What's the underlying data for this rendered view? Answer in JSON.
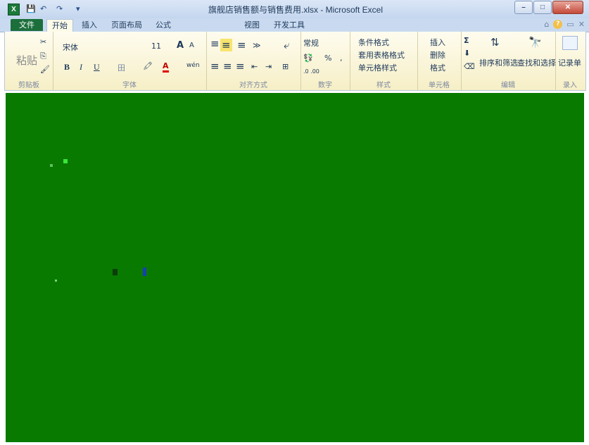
{
  "window": {
    "title": "旗舰店销售额与销售费用.xlsx - Microsoft Excel",
    "app_icon": "X",
    "min": "–",
    "max": "□",
    "close": "✕"
  },
  "qat": {
    "save": "💾",
    "undo": "↶",
    "redo": "↷",
    "more": "▾"
  },
  "tabs": [
    {
      "label": "文件"
    },
    {
      "label": "开始"
    },
    {
      "label": "插入"
    },
    {
      "label": "页面布局"
    },
    {
      "label": "公式"
    },
    {
      "label": "视图"
    },
    {
      "label": "开发工具"
    }
  ],
  "ribbon": {
    "clipboard": {
      "label": "剪贴板",
      "paste": "粘贴",
      "cut": "✂",
      "copy": "⎘",
      "format_painter": "🖌"
    },
    "font": {
      "label": "字体",
      "name": "宋体",
      "size": "11",
      "grow": "A",
      "shrink": "A",
      "bold": "B",
      "italic": "I",
      "underline": "U",
      "border": "田",
      "fill": "🖍",
      "color": "A",
      "phonetic": "wén"
    },
    "alignment": {
      "label": "对齐方式",
      "top": "≡",
      "middle": "≡",
      "bottom": "≡",
      "orientation": "≫",
      "wrap": "⤶",
      "left": "≡",
      "center": "≡",
      "right": "≡",
      "indent_dec": "⇤",
      "indent_inc": "⇥",
      "merge": "⊞"
    },
    "number": {
      "label": "数字",
      "format": "常规",
      "currency": "💱",
      "percent": "%",
      "comma": ",",
      "inc_dec": ".0 .00",
      "dec_dec": ".00 .0"
    },
    "styles": {
      "label": "样式",
      "conditional": "条件格式",
      "table": "套用表格格式",
      "cell": "单元格样式"
    },
    "cells": {
      "label": "单元格",
      "insert": "插入",
      "delete": "删除",
      "format": "格式"
    },
    "editing": {
      "label": "编辑",
      "sum": "Σ",
      "fill": "⬇",
      "clear": "⌫",
      "sort": "排序和筛选",
      "find": "查找和选择"
    },
    "record": {
      "label": "录入",
      "button": "记录单"
    }
  },
  "colors": {
    "sheet_bg": "#087a00",
    "file_tab": "#1c6f3b",
    "ribbon_bg": "#fdfae8"
  }
}
